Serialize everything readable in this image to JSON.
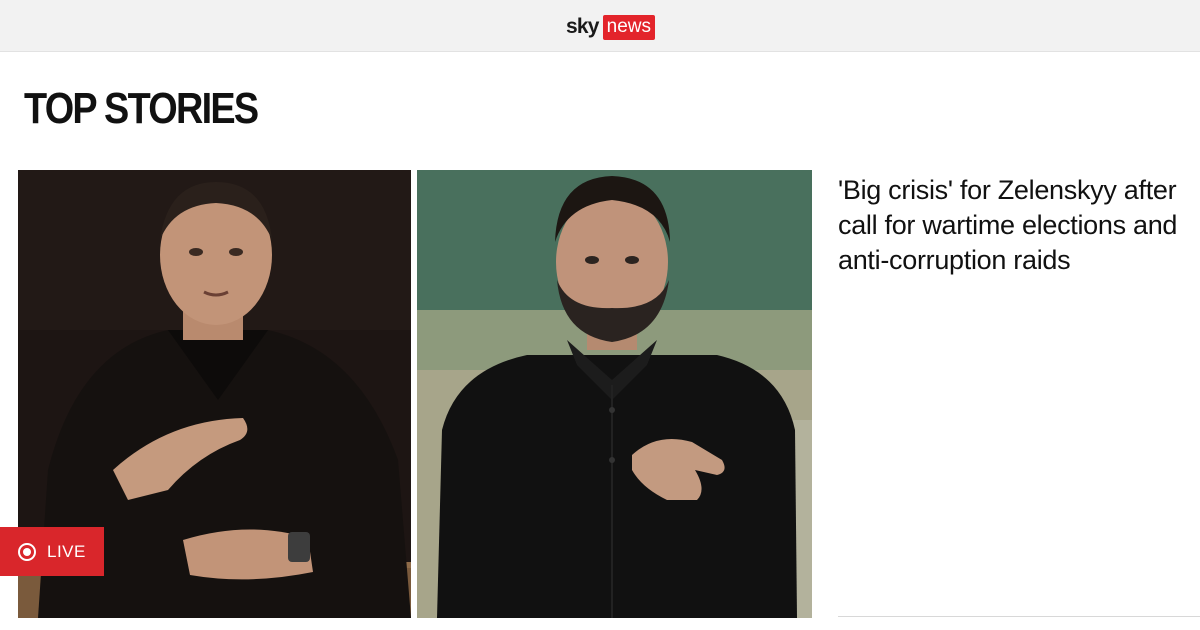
{
  "header": {
    "logo": {
      "sky": "sky",
      "news": "news"
    },
    "colors": {
      "background": "#f2f2f2",
      "brand_red": "#e3242b"
    }
  },
  "section": {
    "title": "TOP STORIES"
  },
  "story": {
    "headline": "'Big crisis' for Zelenskyy after call for wartime elections and anti-corruption raids",
    "live_badge": {
      "label": "LIVE",
      "icon": "live-record-icon",
      "color": "#d9262b"
    },
    "images": [
      {
        "name": "man-speaking-photo"
      },
      {
        "name": "zelenskyy-hand-on-chest-photo"
      }
    ]
  }
}
